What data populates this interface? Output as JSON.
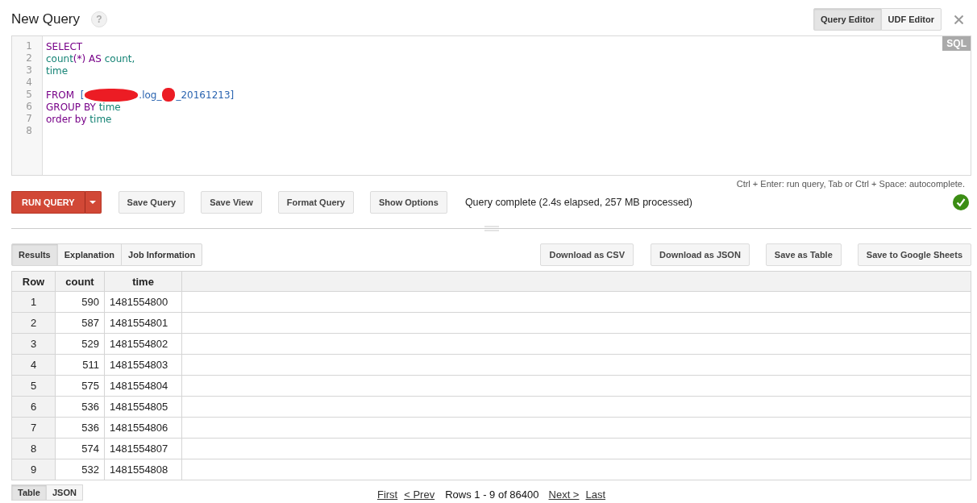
{
  "header": {
    "title": "New Query",
    "help": "?"
  },
  "editor_tabs": [
    {
      "label": "Query Editor",
      "selected": true
    },
    {
      "label": "UDF Editor",
      "selected": false
    }
  ],
  "editor": {
    "language_badge": "SQL",
    "lines": [
      {
        "number": "1",
        "tokens": [
          {
            "kind": "keyword",
            "text": "SELECT"
          }
        ]
      },
      {
        "number": "2",
        "tokens": [
          {
            "kind": "identifier",
            "text": "count"
          },
          {
            "kind": "keyword",
            "text": "(*) AS "
          },
          {
            "kind": "identifier",
            "text": "count,"
          }
        ]
      },
      {
        "number": "3",
        "tokens": [
          {
            "kind": "identifier",
            "text": "time"
          }
        ]
      },
      {
        "number": "4"
      },
      {
        "number": "5",
        "tokens": [
          {
            "kind": "keyword",
            "text": "FROM  "
          },
          {
            "kind": "table",
            "text": "["
          },
          {
            "kind": "redaction"
          },
          {
            "kind": "table",
            "text": ".log_"
          },
          {
            "kind": "redaction"
          },
          {
            "kind": "table",
            "text": "_20161213]"
          }
        ]
      },
      {
        "number": "6",
        "tokens": [
          {
            "kind": "keyword",
            "text": "GROUP BY "
          },
          {
            "kind": "identifier",
            "text": "time"
          }
        ]
      },
      {
        "number": "7",
        "tokens": [
          {
            "kind": "keyword",
            "text": "order by "
          },
          {
            "kind": "identifier",
            "text": "time"
          }
        ]
      },
      {
        "number": "8"
      }
    ],
    "hint": "Ctrl + Enter: run query, Tab or Ctrl + Space: autocomplete."
  },
  "actions": {
    "run": "RUN QUERY",
    "buttons": [
      "Save Query",
      "Save View",
      "Format Query",
      "Show Options"
    ],
    "status": "Query complete (2.4s elapsed, 257 MB processed)",
    "succeeded": true
  },
  "result_tabs": [
    {
      "label": "Results",
      "selected": true
    },
    {
      "label": "Explanation",
      "selected": false
    },
    {
      "label": "Job Information",
      "selected": false
    }
  ],
  "result_actions": [
    "Download as CSV",
    "Download as JSON",
    "Save as Table",
    "Save to Google Sheets"
  ],
  "table": {
    "columns": [
      "Row",
      "count",
      "time"
    ],
    "rows": [
      [
        "1",
        "590",
        "1481554800"
      ],
      [
        "2",
        "587",
        "1481554801"
      ],
      [
        "3",
        "529",
        "1481554802"
      ],
      [
        "4",
        "511",
        "1481554803"
      ],
      [
        "5",
        "575",
        "1481554804"
      ],
      [
        "6",
        "536",
        "1481554805"
      ],
      [
        "7",
        "536",
        "1481554806"
      ],
      [
        "8",
        "574",
        "1481554807"
      ],
      [
        "9",
        "532",
        "1481554808"
      ]
    ]
  },
  "view_toggle": [
    {
      "label": "Table",
      "selected": true
    },
    {
      "label": "JSON",
      "selected": false
    }
  ],
  "pagination": {
    "first": "First",
    "prev": "< Prev",
    "info": "Rows 1 - 9 of 86400",
    "next": "Next >",
    "last": "Last"
  }
}
